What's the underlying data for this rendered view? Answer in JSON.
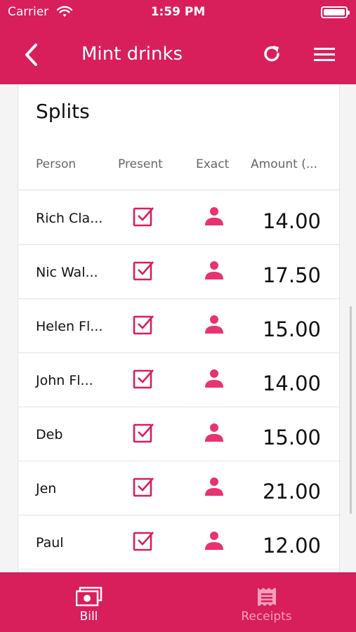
{
  "status_bar": {
    "carrier": "Carrier",
    "time": "1:59 PM"
  },
  "header": {
    "title": "Mint drinks",
    "icons": [
      "back-arrow-icon",
      "refresh-icon",
      "menu-icon"
    ]
  },
  "splits": {
    "title": "Splits",
    "columns": [
      "Person",
      "Present",
      "Exact",
      "Amount (..."
    ],
    "rows": [
      {
        "person": "Rich Cla...",
        "present": true,
        "amount": "14.00"
      },
      {
        "person": "Nic Wal...",
        "present": true,
        "amount": "17.50"
      },
      {
        "person": "Helen Fl...",
        "present": true,
        "amount": "15.00"
      },
      {
        "person": "John Fl...",
        "present": true,
        "amount": "14.00"
      },
      {
        "person": "Deb",
        "present": true,
        "amount": "15.00"
      },
      {
        "person": "Jen",
        "present": true,
        "amount": "21.00"
      },
      {
        "person": "Paul",
        "present": true,
        "amount": "12.00"
      }
    ]
  },
  "tabs": [
    {
      "label": "Bill",
      "icon": "money-icon",
      "active": true
    },
    {
      "label": "Receipts",
      "icon": "receipt-icon",
      "active": false
    }
  ],
  "colors": {
    "accent": "#d81e5b",
    "background": "#f4f4f4"
  }
}
